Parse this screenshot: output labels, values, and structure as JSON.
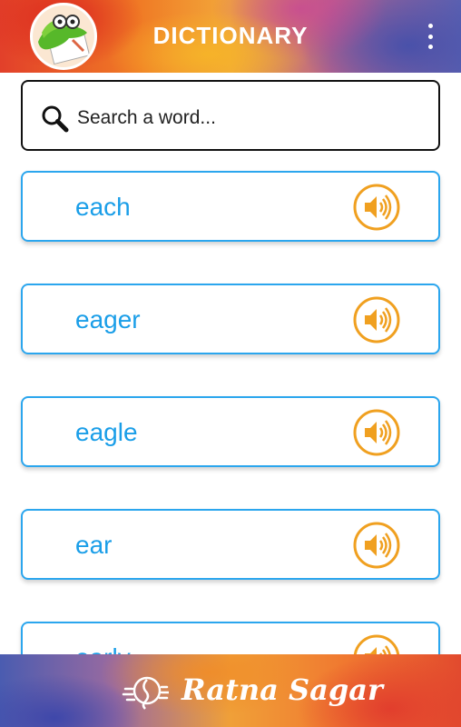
{
  "header": {
    "title": "DICTIONARY",
    "logo_icon": "crocodile-mascot-icon",
    "menu_icon": "more-vert-icon"
  },
  "search": {
    "placeholder": "Search a word...",
    "icon": "search-icon"
  },
  "words": [
    {
      "label": "each",
      "icon": "speaker-icon"
    },
    {
      "label": "eager",
      "icon": "speaker-icon"
    },
    {
      "label": "eagle",
      "icon": "speaker-icon"
    },
    {
      "label": "ear",
      "icon": "speaker-icon"
    },
    {
      "label": "early",
      "icon": "speaker-icon"
    }
  ],
  "footer": {
    "brand": "Ratna Sagar",
    "brand_icon": "seahorse-logo-icon"
  },
  "colors": {
    "word_text": "#1a9ee8",
    "card_border": "#2ba6ee",
    "speaker": "#f0a020"
  }
}
